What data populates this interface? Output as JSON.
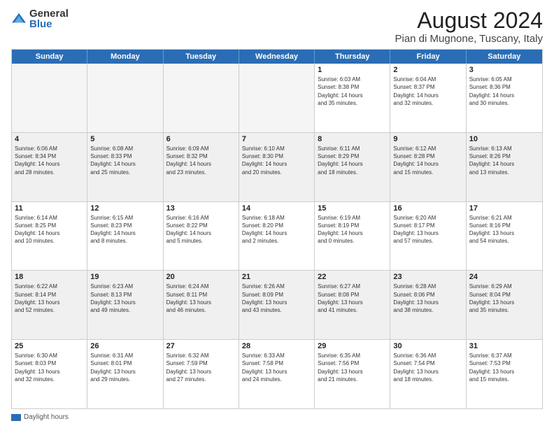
{
  "logo": {
    "general": "General",
    "blue": "Blue"
  },
  "title": "August 2024",
  "subtitle": "Pian di Mugnone, Tuscany, Italy",
  "days_of_week": [
    "Sunday",
    "Monday",
    "Tuesday",
    "Wednesday",
    "Thursday",
    "Friday",
    "Saturday"
  ],
  "footer_label": "Daylight hours",
  "weeks": [
    [
      {
        "num": "",
        "info": "",
        "empty": true
      },
      {
        "num": "",
        "info": "",
        "empty": true
      },
      {
        "num": "",
        "info": "",
        "empty": true
      },
      {
        "num": "",
        "info": "",
        "empty": true
      },
      {
        "num": "1",
        "info": "Sunrise: 6:03 AM\nSunset: 8:38 PM\nDaylight: 14 hours\nand 35 minutes.",
        "empty": false
      },
      {
        "num": "2",
        "info": "Sunrise: 6:04 AM\nSunset: 8:37 PM\nDaylight: 14 hours\nand 32 minutes.",
        "empty": false
      },
      {
        "num": "3",
        "info": "Sunrise: 6:05 AM\nSunset: 8:36 PM\nDaylight: 14 hours\nand 30 minutes.",
        "empty": false
      }
    ],
    [
      {
        "num": "4",
        "info": "Sunrise: 6:06 AM\nSunset: 8:34 PM\nDaylight: 14 hours\nand 28 minutes.",
        "empty": false,
        "shaded": true
      },
      {
        "num": "5",
        "info": "Sunrise: 6:08 AM\nSunset: 8:33 PM\nDaylight: 14 hours\nand 25 minutes.",
        "empty": false,
        "shaded": true
      },
      {
        "num": "6",
        "info": "Sunrise: 6:09 AM\nSunset: 8:32 PM\nDaylight: 14 hours\nand 23 minutes.",
        "empty": false,
        "shaded": true
      },
      {
        "num": "7",
        "info": "Sunrise: 6:10 AM\nSunset: 8:30 PM\nDaylight: 14 hours\nand 20 minutes.",
        "empty": false,
        "shaded": true
      },
      {
        "num": "8",
        "info": "Sunrise: 6:11 AM\nSunset: 8:29 PM\nDaylight: 14 hours\nand 18 minutes.",
        "empty": false,
        "shaded": true
      },
      {
        "num": "9",
        "info": "Sunrise: 6:12 AM\nSunset: 8:28 PM\nDaylight: 14 hours\nand 15 minutes.",
        "empty": false,
        "shaded": true
      },
      {
        "num": "10",
        "info": "Sunrise: 6:13 AM\nSunset: 8:26 PM\nDaylight: 14 hours\nand 13 minutes.",
        "empty": false,
        "shaded": true
      }
    ],
    [
      {
        "num": "11",
        "info": "Sunrise: 6:14 AM\nSunset: 8:25 PM\nDaylight: 14 hours\nand 10 minutes.",
        "empty": false
      },
      {
        "num": "12",
        "info": "Sunrise: 6:15 AM\nSunset: 8:23 PM\nDaylight: 14 hours\nand 8 minutes.",
        "empty": false
      },
      {
        "num": "13",
        "info": "Sunrise: 6:16 AM\nSunset: 8:22 PM\nDaylight: 14 hours\nand 5 minutes.",
        "empty": false
      },
      {
        "num": "14",
        "info": "Sunrise: 6:18 AM\nSunset: 8:20 PM\nDaylight: 14 hours\nand 2 minutes.",
        "empty": false
      },
      {
        "num": "15",
        "info": "Sunrise: 6:19 AM\nSunset: 8:19 PM\nDaylight: 14 hours\nand 0 minutes.",
        "empty": false
      },
      {
        "num": "16",
        "info": "Sunrise: 6:20 AM\nSunset: 8:17 PM\nDaylight: 13 hours\nand 57 minutes.",
        "empty": false
      },
      {
        "num": "17",
        "info": "Sunrise: 6:21 AM\nSunset: 8:16 PM\nDaylight: 13 hours\nand 54 minutes.",
        "empty": false
      }
    ],
    [
      {
        "num": "18",
        "info": "Sunrise: 6:22 AM\nSunset: 8:14 PM\nDaylight: 13 hours\nand 52 minutes.",
        "empty": false,
        "shaded": true
      },
      {
        "num": "19",
        "info": "Sunrise: 6:23 AM\nSunset: 8:13 PM\nDaylight: 13 hours\nand 49 minutes.",
        "empty": false,
        "shaded": true
      },
      {
        "num": "20",
        "info": "Sunrise: 6:24 AM\nSunset: 8:11 PM\nDaylight: 13 hours\nand 46 minutes.",
        "empty": false,
        "shaded": true
      },
      {
        "num": "21",
        "info": "Sunrise: 6:26 AM\nSunset: 8:09 PM\nDaylight: 13 hours\nand 43 minutes.",
        "empty": false,
        "shaded": true
      },
      {
        "num": "22",
        "info": "Sunrise: 6:27 AM\nSunset: 8:08 PM\nDaylight: 13 hours\nand 41 minutes.",
        "empty": false,
        "shaded": true
      },
      {
        "num": "23",
        "info": "Sunrise: 6:28 AM\nSunset: 8:06 PM\nDaylight: 13 hours\nand 38 minutes.",
        "empty": false,
        "shaded": true
      },
      {
        "num": "24",
        "info": "Sunrise: 6:29 AM\nSunset: 8:04 PM\nDaylight: 13 hours\nand 35 minutes.",
        "empty": false,
        "shaded": true
      }
    ],
    [
      {
        "num": "25",
        "info": "Sunrise: 6:30 AM\nSunset: 8:03 PM\nDaylight: 13 hours\nand 32 minutes.",
        "empty": false
      },
      {
        "num": "26",
        "info": "Sunrise: 6:31 AM\nSunset: 8:01 PM\nDaylight: 13 hours\nand 29 minutes.",
        "empty": false
      },
      {
        "num": "27",
        "info": "Sunrise: 6:32 AM\nSunset: 7:59 PM\nDaylight: 13 hours\nand 27 minutes.",
        "empty": false
      },
      {
        "num": "28",
        "info": "Sunrise: 6:33 AM\nSunset: 7:58 PM\nDaylight: 13 hours\nand 24 minutes.",
        "empty": false
      },
      {
        "num": "29",
        "info": "Sunrise: 6:35 AM\nSunset: 7:56 PM\nDaylight: 13 hours\nand 21 minutes.",
        "empty": false
      },
      {
        "num": "30",
        "info": "Sunrise: 6:36 AM\nSunset: 7:54 PM\nDaylight: 13 hours\nand 18 minutes.",
        "empty": false
      },
      {
        "num": "31",
        "info": "Sunrise: 6:37 AM\nSunset: 7:53 PM\nDaylight: 13 hours\nand 15 minutes.",
        "empty": false
      }
    ]
  ]
}
